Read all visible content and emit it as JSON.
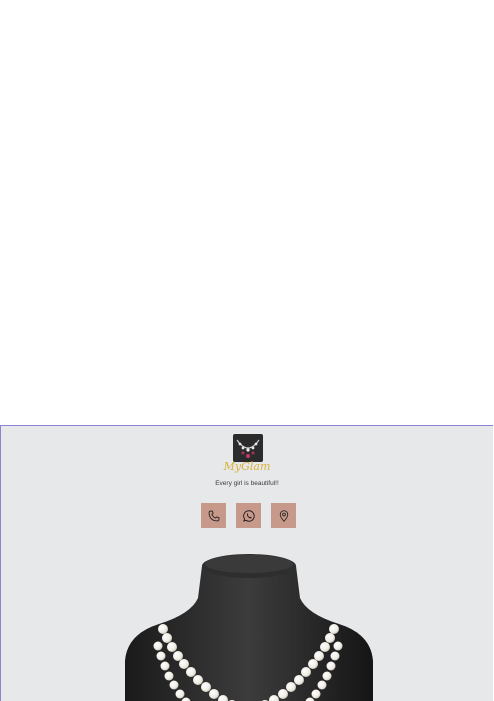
{
  "header": {
    "brand_name": "MyGlam",
    "tagline": "Every girl is beautiful!!"
  },
  "contact_buttons": [
    {
      "icon": "phone-icon"
    },
    {
      "icon": "whatsapp-icon"
    },
    {
      "icon": "location-pin-icon"
    }
  ],
  "colors": {
    "background": "#e7e8ea",
    "button": "#c7998a",
    "brand": "#d9b23a",
    "frame_border": "#8d83d2"
  }
}
